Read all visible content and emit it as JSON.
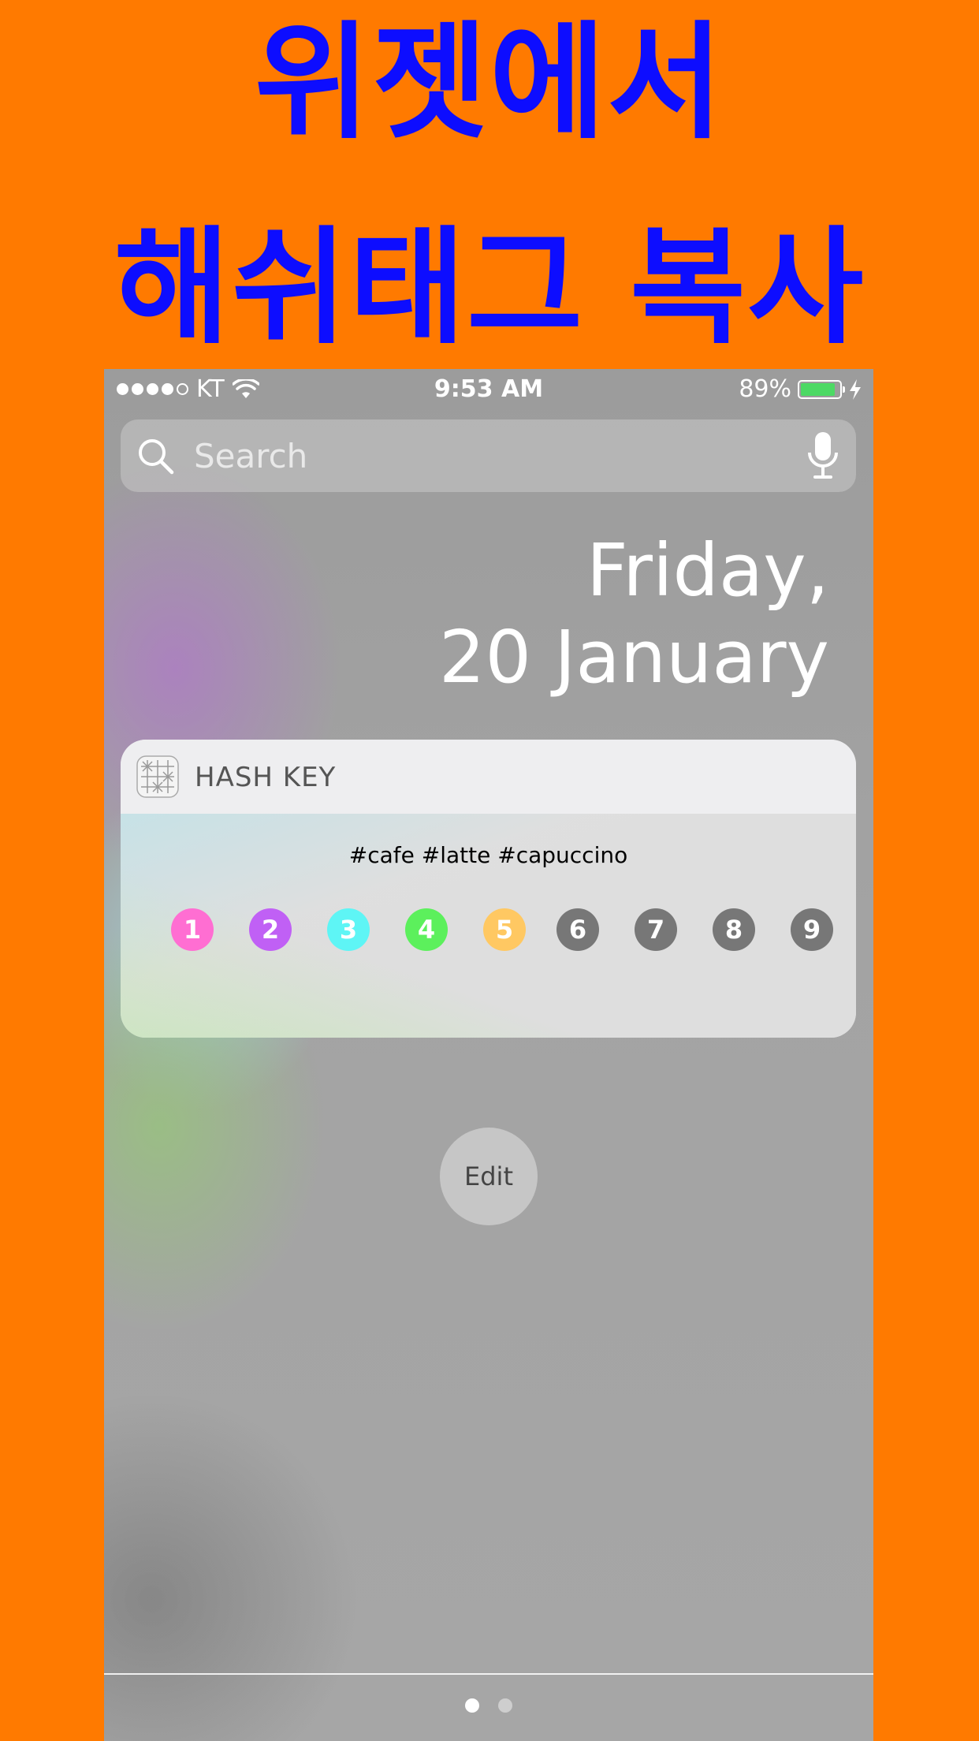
{
  "headline": {
    "line1": "위젯에서",
    "line2": "해쉬태그 복사"
  },
  "status_bar": {
    "carrier": "KT",
    "time": "9:53 AM",
    "battery": "89%",
    "battery_level": 0.89,
    "signal_bars_filled": 4,
    "signal_bars_total": 5
  },
  "search": {
    "placeholder": "Search"
  },
  "date": {
    "weekday": "Friday,",
    "day_month": "20 January"
  },
  "widget": {
    "title": "HASH KEY",
    "hashtags": "#cafe #latte #capuccino",
    "keys": [
      {
        "label": "1",
        "color": "#ff6ed2"
      },
      {
        "label": "2",
        "color": "#c060f5"
      },
      {
        "label": "3",
        "color": "#5ef5f5"
      },
      {
        "label": "4",
        "color": "#5cf05c"
      },
      {
        "label": "5",
        "color": "#ffc862"
      },
      {
        "label": "6",
        "color": "#777777"
      },
      {
        "label": "7",
        "color": "#777777"
      },
      {
        "label": "8",
        "color": "#777777"
      },
      {
        "label": "9",
        "color": "#777777"
      }
    ]
  },
  "edit_button": {
    "label": "Edit"
  },
  "pager": {
    "pages": 2,
    "active": 0
  },
  "colors": {
    "background": "#ff7a00",
    "headline": "#0d0dff",
    "battery_fill": "#4cd964"
  }
}
